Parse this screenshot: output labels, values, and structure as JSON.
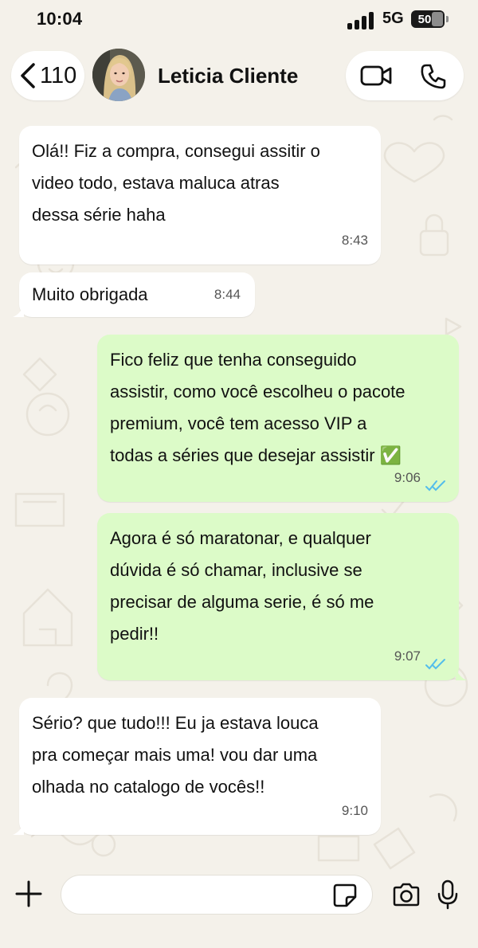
{
  "status": {
    "time": "10:04",
    "network": "5G",
    "battery": "50"
  },
  "header": {
    "back_count": "110",
    "contact_name": "Leticia Cliente"
  },
  "messages": [
    {
      "direction": "in",
      "text_lines": [
        "Olá!! Fiz a compra, consegui assitir o",
        "video todo, estava maluca atras",
        "dessa série haha"
      ],
      "time": "8:43"
    },
    {
      "direction": "in",
      "text_lines": [
        "Muito obrigada"
      ],
      "time": "8:44"
    },
    {
      "direction": "out",
      "text_lines": [
        "Fico feliz que tenha conseguido",
        "assistir, como você escolheu o pacote",
        "premium, você tem acesso VIP a",
        "todas a séries que desejar assistir ✅"
      ],
      "time": "9:06",
      "status": "read"
    },
    {
      "direction": "out",
      "text_lines": [
        "Agora é só maratonar, e qualquer",
        "dúvida é só chamar, inclusive se",
        "precisar de alguma serie, é só me",
        "pedir!!"
      ],
      "time": "9:07",
      "status": "read"
    },
    {
      "direction": "in",
      "text_lines": [
        "Sério? que tudo!!! Eu ja estava louca",
        "pra começar mais uma! vou dar uma",
        "olhada no catalogo de vocês!!"
      ],
      "time": "9:10"
    }
  ],
  "composer": {
    "placeholder": ""
  },
  "colors": {
    "incoming": "#ffffff",
    "outgoing": "#dcfbc8",
    "read_ticks": "#53bdeb",
    "background": "#f4f1ea"
  },
  "icons": [
    "back-chevron-icon",
    "video-call-icon",
    "phone-icon",
    "plus-icon",
    "sticker-icon",
    "camera-icon",
    "mic-icon"
  ]
}
